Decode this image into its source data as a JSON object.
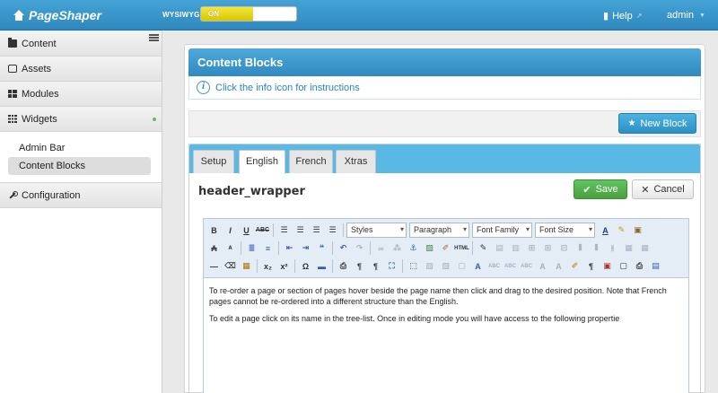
{
  "header": {
    "logo_text": "PageShaper",
    "wysiwyg_label": "WYSIWYG",
    "wysiwyg_state": "ON",
    "help_label": "Help",
    "user_label": "admin"
  },
  "sidebar": {
    "items": [
      {
        "label": "Content",
        "icon": "folder-icon"
      },
      {
        "label": "Assets",
        "icon": "drive-icon"
      },
      {
        "label": "Modules",
        "icon": "modules-icon"
      },
      {
        "label": "Widgets",
        "icon": "grid-icon"
      },
      {
        "label": "Configuration",
        "icon": "wrench-icon"
      }
    ],
    "widgets_sub": [
      {
        "label": "Admin Bar"
      },
      {
        "label": "Content Blocks"
      }
    ]
  },
  "panel": {
    "title": "Content Blocks",
    "info_text": "Click the info icon for instructions",
    "new_block_label": "New Block"
  },
  "editor": {
    "tabs": [
      {
        "label": "Setup"
      },
      {
        "label": "English"
      },
      {
        "label": "French"
      },
      {
        "label": "Xtras"
      }
    ],
    "active_tab": "English",
    "block_name": "header_wrapper",
    "save_label": "Save",
    "cancel_label": "Cancel",
    "styles_label": "Styles",
    "format_label": "Paragraph",
    "font_family_label": "Font Family",
    "font_size_label": "Font Size",
    "body_paragraphs": [
      "To re-order a page or section of pages hover beside the page name then click and drag to the desired position. Note that French pages cannot be re-ordered into a different structure than the English.",
      "To edit a page click on its name in the tree-list. Once in editing mode you will have access to the following propertie"
    ]
  },
  "colors": {
    "topbar": "#3a96c9",
    "accent": "#2f88bd",
    "save": "#4a9f3e",
    "toggle_on": "#e3d400"
  }
}
